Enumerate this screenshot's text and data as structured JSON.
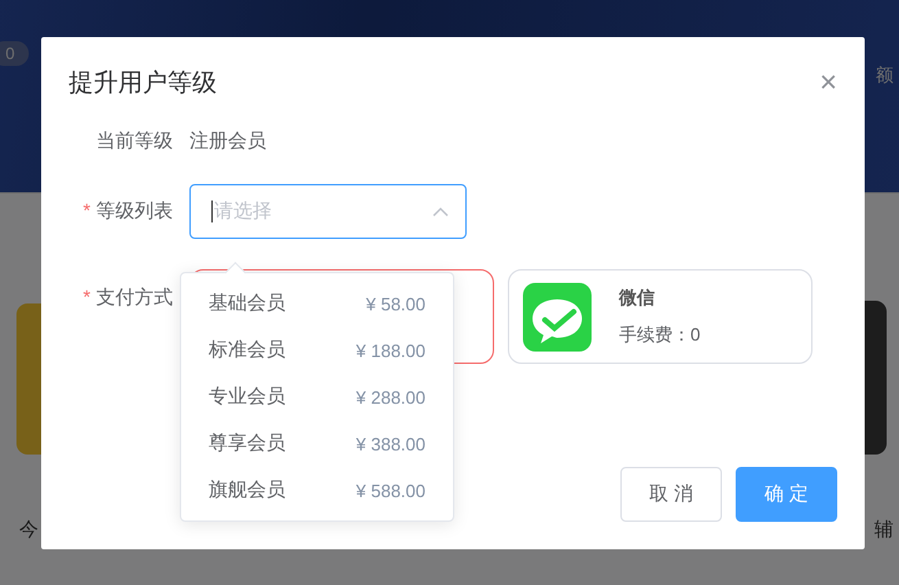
{
  "background": {
    "badge": "0",
    "right_top_text": "额",
    "left_bottom_text": "今",
    "right_bottom_text": "辅"
  },
  "dialog": {
    "title": "提升用户等级",
    "close": "×",
    "current_level": {
      "label": "当前等级",
      "value": "注册会员"
    },
    "level_select": {
      "label": "等级列表",
      "required_mark": "*",
      "placeholder": "请选择",
      "expanded": true,
      "options": [
        {
          "name": "基础会员",
          "price": "¥ 58.00"
        },
        {
          "name": "标准会员",
          "price": "¥ 188.00"
        },
        {
          "name": "专业会员",
          "price": "¥ 288.00"
        },
        {
          "name": "尊享会员",
          "price": "¥ 388.00"
        },
        {
          "name": "旗舰会员",
          "price": "¥ 588.00"
        }
      ]
    },
    "payment": {
      "label": "支付方式",
      "required_mark": "*",
      "methods": [
        {
          "selected": true
        },
        {
          "name": "微信",
          "fee": "手续费：0",
          "selected": false
        }
      ]
    },
    "buttons": [
      {
        "label": "取 消",
        "kind": "default"
      },
      {
        "label": "确 定",
        "kind": "primary"
      }
    ]
  }
}
